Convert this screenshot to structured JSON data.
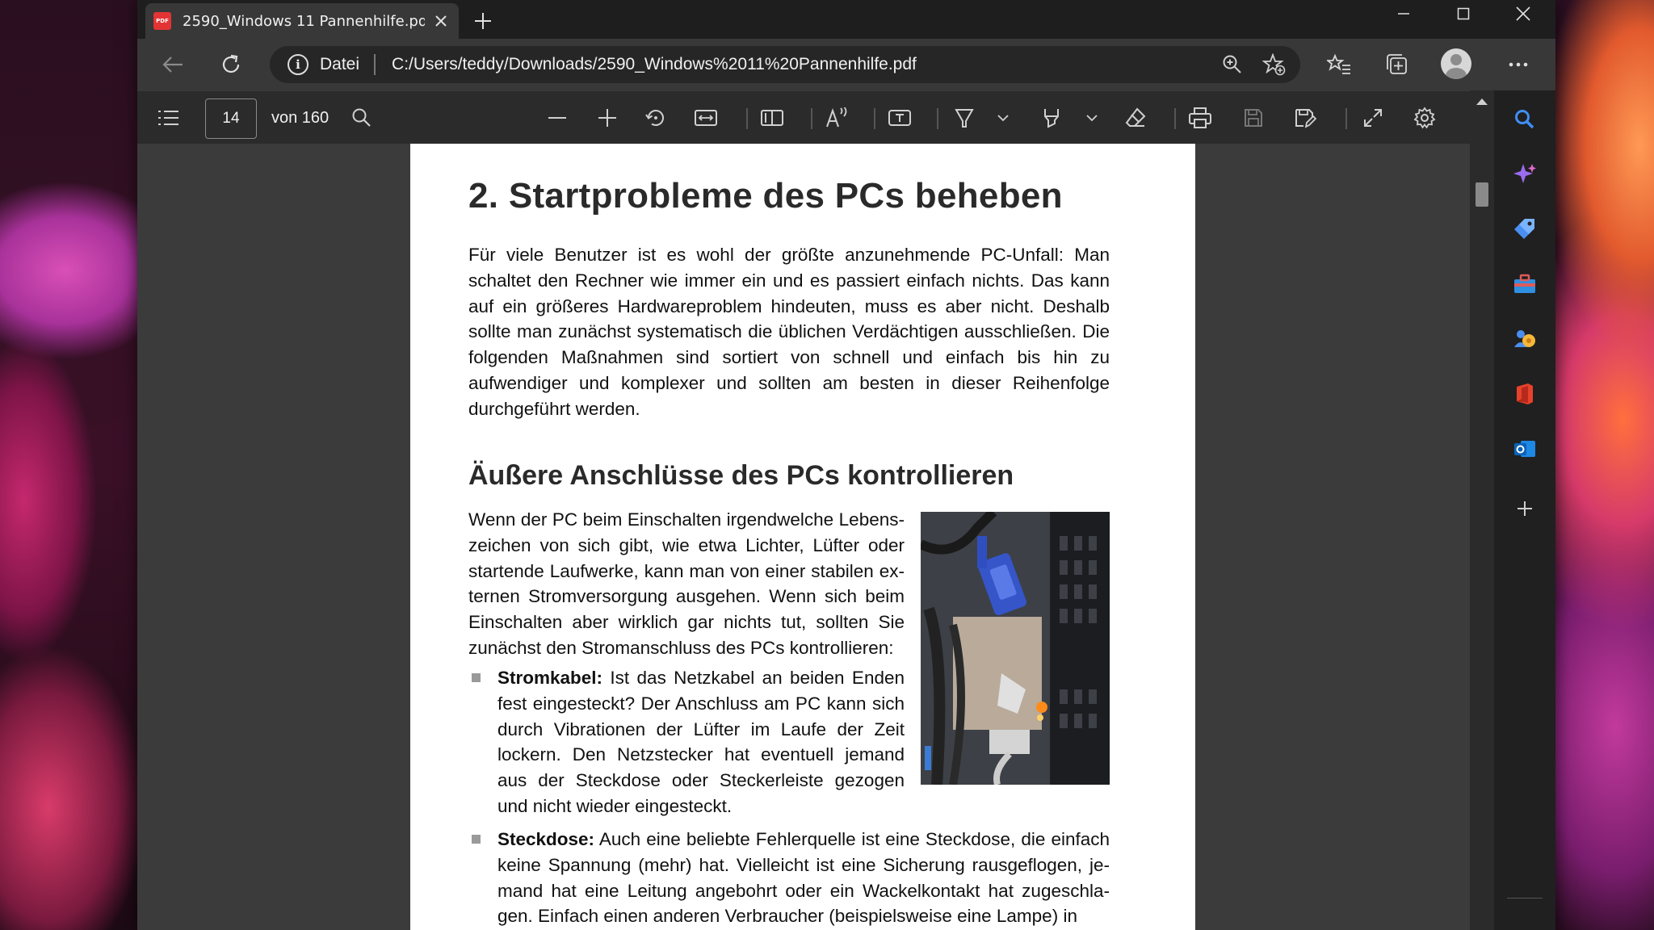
{
  "browser": {
    "tab": {
      "title": "2590_Windows 11 Pannenhilfe.pdf",
      "pdf_badge": "PDF"
    },
    "address": {
      "scheme_label": "Datei",
      "url": "C:/Users/teddy/Downloads/2590_Windows%2011%20Pannenhilfe.pdf"
    }
  },
  "pdf_toolbar": {
    "current_page": "14",
    "total_label": "von 160"
  },
  "document": {
    "chapter_title": "2. Startprobleme des PCs beheben",
    "intro": "Für viele Benutzer ist es wohl der größte anzunehmende PC-Unfall: Man schaltet den Rechner wie immer ein und es passiert einfach nichts. Das kann auf ein größeres Hardwareproblem hindeuten, muss es aber nicht. Deshalb sollte man zunächst systematisch die üblichen Verdächtigen ausschließen. Die folgenden Maßnahmen sind sortiert von schnell und einfach bis hin zu aufwendiger und komplexer und sollten am besten in dieser Reihenfolge durchgeführt werden.",
    "section_title": "Äußere Anschlüsse des PCs kontrollieren",
    "section_para": "Wenn der PC beim Einschalten irgendwelche Lebens­zeichen von sich gibt, wie etwa Lichter, Lüfter oder startende Laufwerke, kann man von einer stabilen ex­ternen Stromversorgung ausgehen. Wenn sich beim Einschalten aber wirklich gar nichts tut, sollten Sie zunächst den Stromanschluss des PCs kontrollieren:",
    "bullets": [
      {
        "term": "Stromkabel:",
        "text": " Ist das Netzkabel an beiden Enden fest eingesteckt? Der Anschluss am PC kann sich durch Vibrationen der Lüfter im Laufe der Zeit lockern. Den Netzstecker hat eventuell jemand aus der Steckdose oder Steckerleiste gezogen und nicht wieder eingesteckt."
      },
      {
        "term": "Steckdose:",
        "text": " Auch eine beliebte Fehlerquelle ist eine Steckdose, die einfach keine Spannung (mehr) hat. Vielleicht ist eine Sicherung rausgeflogen, je­mand hat eine Leitung angebohrt oder ein Wackelkontakt hat zugeschla­gen. Einfach einen anderen Verbraucher (beispielsweise eine Lampe) in"
      }
    ]
  },
  "colors": {
    "page_bg": "#ffffff",
    "viewer_bg": "#3b3b3b",
    "toolbar_bg": "#2b2b2b",
    "copilot_accent": "#a86cf0",
    "search_accent": "#3f8ef5",
    "office_red": "#e8412c",
    "outlook_blue": "#1e88e5"
  }
}
